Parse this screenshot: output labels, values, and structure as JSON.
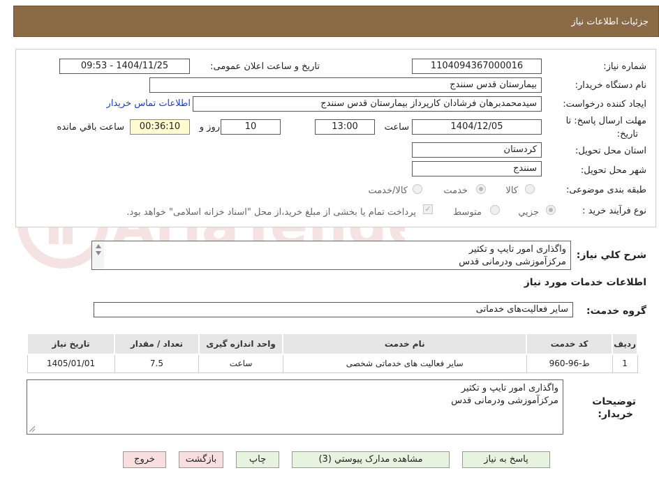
{
  "header": {
    "title": "جزئیات اطلاعات نیاز"
  },
  "form": {
    "need_number_label": "شماره نیاز:",
    "need_number": "1104094367000016",
    "announce_label": "تاریخ و ساعت اعلان عمومی:",
    "announce_value": "1404/11/25 - 09:53",
    "buyer_org_label": "نام دستگاه خریدار:",
    "buyer_org": "بیمارستان قدس سنندج",
    "requester_label": "ایجاد کننده درخواست:",
    "requester": "سیدمحمدبرهان فرشادان کارپرداز بیمارستان قدس سنندج",
    "contact_link": "اطلاعات تماس خریدار",
    "deadline_label_1": "مهلت ارسال پاسخ: تا",
    "deadline_label_2": "تاریخ:",
    "deadline_date": "1404/12/05",
    "time_label": "ساعت",
    "deadline_time": "13:00",
    "days_value": "10",
    "days_label": "روز و",
    "remaining_time": "00:36:10",
    "remaining_label": "ساعت باقي مانده",
    "province_label": "استان محل تحویل:",
    "province": "کردستان",
    "city_label": "شهر محل تحویل:",
    "city": "سنندج",
    "category_label": "طبقه بندی موضوعی:",
    "category_options": [
      "کالا",
      "خدمت",
      "کالا/خدمت"
    ],
    "category_selected": "خدمت",
    "process_label": "نوع فرآیند خرید :",
    "process_options": [
      "جزیي",
      "متوسط"
    ],
    "process_selected": "جزیي",
    "payment_note": "پرداخت تمام یا بخشی از مبلغ خرید،از محل \"اسناد خزانه اسلامی\" خواهد بود.",
    "payment_checked": true
  },
  "description": {
    "label": "شرح کلي نياز:",
    "lines": [
      "واگذاری امور تایپ و تکثیر",
      "مرکزآموزشی ودرمانی قدس"
    ]
  },
  "services_heading": "اطلاعات خدمات مورد نیاز",
  "service_group": {
    "label": "گروه خدمت:",
    "value": "سایر فعالیت‌های خدماتی"
  },
  "table": {
    "headers": [
      "ردیف",
      "کد خدمت",
      "نام خدمت",
      "واحد اندازه گیری",
      "تعداد / مقدار",
      "تاریخ نیاز"
    ],
    "rows": [
      [
        "1",
        "ط-96-960",
        "سایر فعالیت های خدماتی شخصی",
        "ساعت",
        "7.5",
        "1405/01/01"
      ]
    ]
  },
  "buyer_notes": {
    "label_1": "توضیحات",
    "label_2": "خریدار:",
    "lines": [
      "واگذاری امور تایپ و تکثیر",
      "مرکزآموزشی ودرمانی قدس"
    ]
  },
  "buttons": {
    "reply": "پاسخ به نیاز",
    "attachments": "مشاهده مدارک پیوستي (3)",
    "print": "چاپ",
    "back": "بازگشت",
    "exit": "خروج"
  },
  "watermark_text": "AriaTender.neT",
  "colors": {
    "header_bg": "#8b6a46",
    "link": "#1a3fc9",
    "remaining_bg": "#fffbd0",
    "button_green": "#e6f4df",
    "button_red": "#f9dede"
  }
}
